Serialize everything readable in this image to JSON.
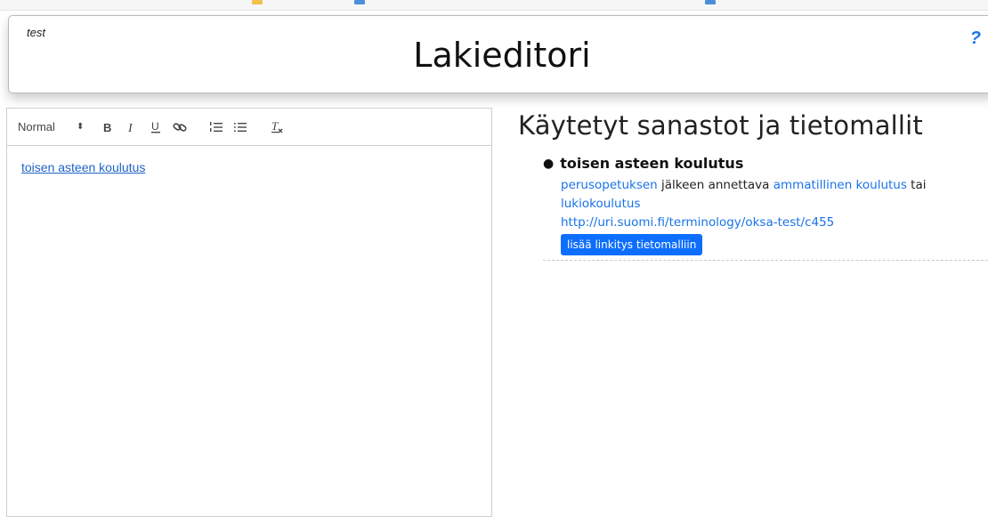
{
  "header": {
    "env_label": "test",
    "title": "Lakieditori",
    "help_label": "?"
  },
  "editor": {
    "format_select": {
      "value": "Normal"
    },
    "toolbar_icons": [
      "bold-icon",
      "italic-icon",
      "underline-icon",
      "link-icon",
      "ordered-list-icon",
      "bullet-list-icon",
      "clear-format-icon"
    ],
    "content_link": "toisen asteen koulutus"
  },
  "vocabularies": {
    "title": "Käytetyt sanastot ja tietomallit",
    "term": {
      "name": "toisen asteen koulutus",
      "def_link1": "perusopetuksen",
      "def_text1": " jälkeen annettava ",
      "def_link2": "ammatillinen koulutus",
      "def_text2": " tai",
      "def_link3": "lukiokoulutus",
      "uri": "http://uri.suomi.fi/terminology/oksa-test/c455",
      "button_label": "lisää linkitys tietomalliin"
    }
  },
  "colors": {
    "link": "#1a73e8",
    "button": "#0d6efd"
  }
}
